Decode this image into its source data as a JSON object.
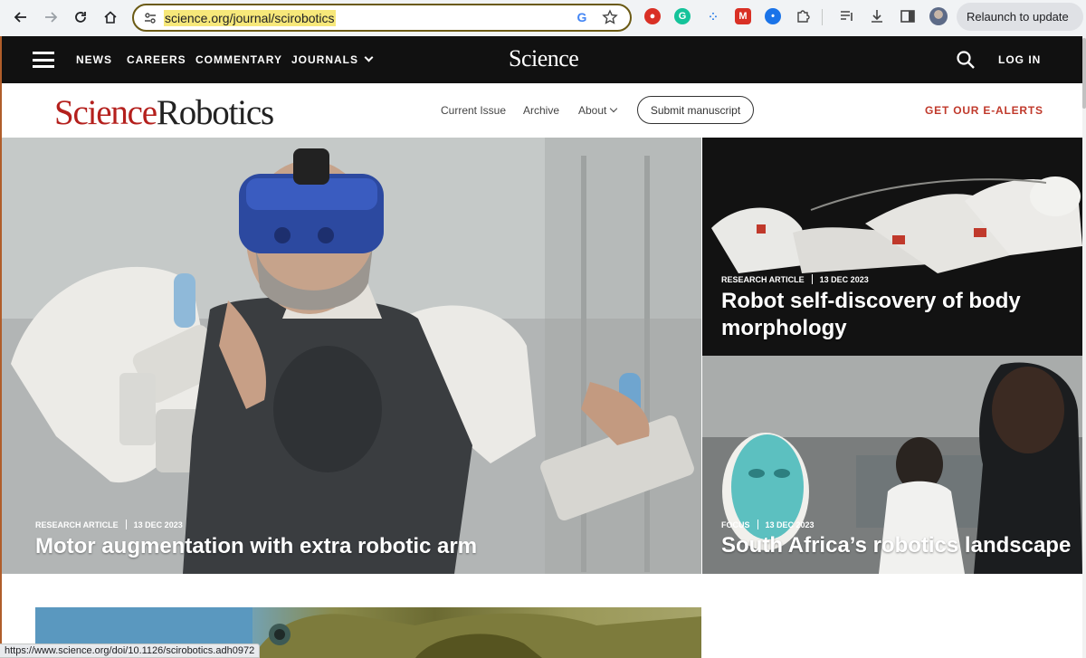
{
  "browser": {
    "url": "science.org/journal/scirobotics",
    "relaunch_label": "Relaunch to update",
    "status_url": "https://www.science.org/doi/10.1126/scirobotics.adh0972"
  },
  "topnav": {
    "links": [
      "NEWS",
      "CAREERS",
      "COMMENTARY",
      "JOURNALS"
    ],
    "logo": "Science",
    "login": "LOG IN"
  },
  "journal": {
    "logo_part1": "Science",
    "logo_part2": "Robotics",
    "nav": [
      "Current Issue",
      "Archive",
      "About"
    ],
    "submit": "Submit manuscript",
    "alerts": "GET OUR E-ALERTS"
  },
  "featured": {
    "main": {
      "type": "RESEARCH ARTICLE",
      "date": "13 DEC 2023",
      "title": "Motor augmentation with extra robotic arm"
    },
    "side1": {
      "type": "RESEARCH ARTICLE",
      "date": "13 DEC 2023",
      "title": "Robot self-discovery of body morphology"
    },
    "side2": {
      "type": "FOCUS",
      "date": "13 DEC 2023",
      "title": "South Africa’s robotics landscape"
    }
  },
  "colors": {
    "brand_red": "#b4201d",
    "alerts": "#c0392b",
    "nav_bg": "#111111"
  }
}
